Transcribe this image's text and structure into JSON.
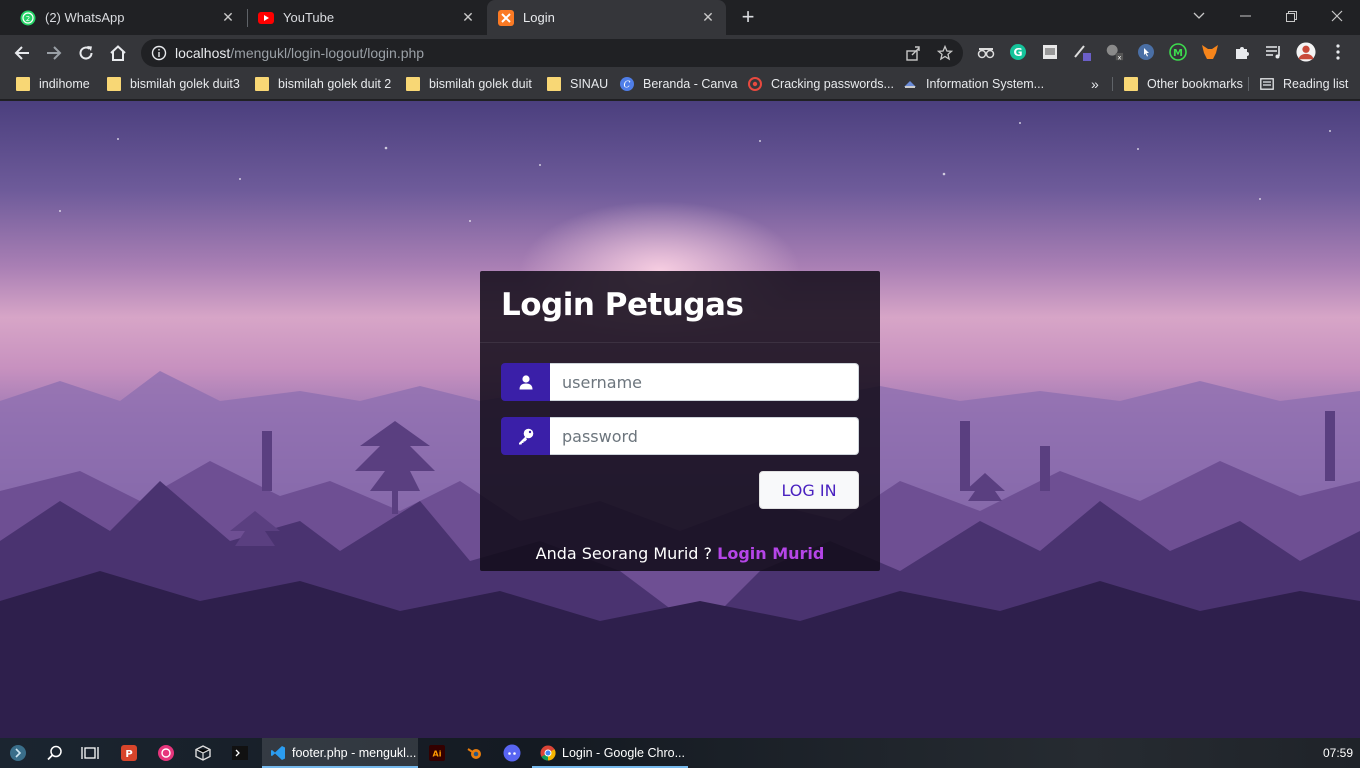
{
  "browser": {
    "tabs": [
      {
        "title": "(2) WhatsApp",
        "favicon": "whatsapp-icon",
        "active": false
      },
      {
        "title": "YouTube",
        "favicon": "youtube-icon",
        "active": false
      },
      {
        "title": "Login",
        "favicon": "xampp-icon",
        "active": true
      }
    ],
    "url_host": "localhost",
    "url_path": "/mengukl/login-logout/login.php",
    "bookmarks": [
      {
        "label": "indihome",
        "icon": "folder-icon"
      },
      {
        "label": "bismilah golek duit3",
        "icon": "folder-icon"
      },
      {
        "label": "bismilah golek duit 2",
        "icon": "folder-icon"
      },
      {
        "label": "bismilah golek duit",
        "icon": "folder-icon"
      },
      {
        "label": "SINAU",
        "icon": "folder-icon"
      },
      {
        "label": "Beranda - Canva",
        "icon": "canva-icon"
      },
      {
        "label": "Cracking passwords...",
        "icon": "target-icon"
      },
      {
        "label": "Information System...",
        "icon": "site-icon"
      },
      {
        "label": "Other bookmarks",
        "icon": "folder-icon"
      },
      {
        "label": "Reading list",
        "icon": "reading-list-icon"
      }
    ],
    "overflow_label": "»"
  },
  "login": {
    "title": "Login Petugas",
    "username_placeholder": "username",
    "password_placeholder": "password",
    "button_label": "LOG IN",
    "student_prompt": "Anda Seorang Murid ?",
    "student_link": "Login Murid"
  },
  "taskbar": {
    "apps": [
      {
        "label": "footer.php - mengukl...",
        "icon": "vscode-icon"
      },
      {
        "label": "Login - Google Chro...",
        "icon": "chrome-icon"
      }
    ],
    "time": "07:59"
  },
  "colors": {
    "accent": "#3a1fa8",
    "link": "#b545e8",
    "button_text": "#4a22c0"
  }
}
